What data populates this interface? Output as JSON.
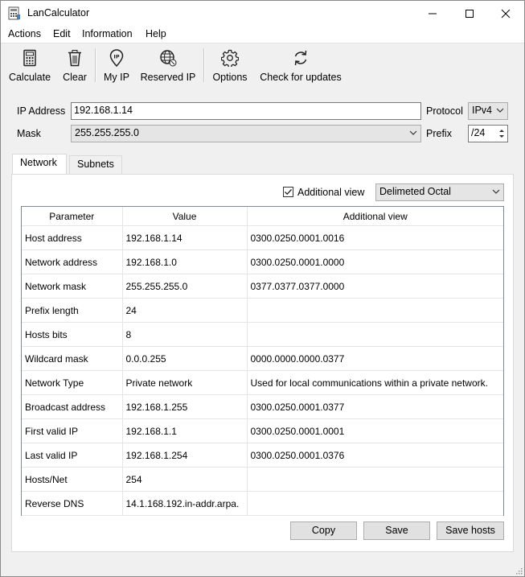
{
  "window": {
    "title": "LanCalculator"
  },
  "menu": [
    "Actions",
    "Edit",
    "Information",
    "Help"
  ],
  "toolbar": {
    "calculate": "Calculate",
    "clear": "Clear",
    "my_ip": "My IP",
    "reserved_ip": "Reserved IP",
    "options": "Options",
    "check_updates": "Check for updates"
  },
  "form": {
    "ip_label": "IP Address",
    "ip_value": "192.168.1.14",
    "protocol_label": "Protocol",
    "protocol_value": "IPv4",
    "mask_label": "Mask",
    "mask_value": "255.255.255.0",
    "prefix_label": "Prefix",
    "prefix_value": "/24"
  },
  "tabs": [
    "Network",
    "Subnets"
  ],
  "view": {
    "checkbox_label": "Additional view",
    "checked": true,
    "format_value": "Delimeted Octal"
  },
  "table": {
    "headers": [
      "Parameter",
      "Value",
      "Additional view"
    ],
    "rows": [
      [
        "Host address",
        "192.168.1.14",
        "0300.0250.0001.0016"
      ],
      [
        "Network address",
        "192.168.1.0",
        "0300.0250.0001.0000"
      ],
      [
        "Network mask",
        "255.255.255.0",
        "0377.0377.0377.0000"
      ],
      [
        "Prefix length",
        "24",
        ""
      ],
      [
        "Hosts bits",
        "8",
        ""
      ],
      [
        "Wildcard mask",
        "0.0.0.255",
        "0000.0000.0000.0377"
      ],
      [
        "Network Type",
        "Private network",
        "Used for local communications within a private network."
      ],
      [
        "Broadcast address",
        "192.168.1.255",
        "0300.0250.0001.0377"
      ],
      [
        "First valid IP",
        "192.168.1.1",
        "0300.0250.0001.0001"
      ],
      [
        "Last valid IP",
        "192.168.1.254",
        "0300.0250.0001.0376"
      ],
      [
        "Hosts/Net",
        "254",
        ""
      ],
      [
        "Reverse DNS",
        "14.1.168.192.in-addr.arpa.",
        ""
      ]
    ]
  },
  "buttons": {
    "copy": "Copy",
    "save": "Save",
    "save_hosts": "Save hosts"
  }
}
